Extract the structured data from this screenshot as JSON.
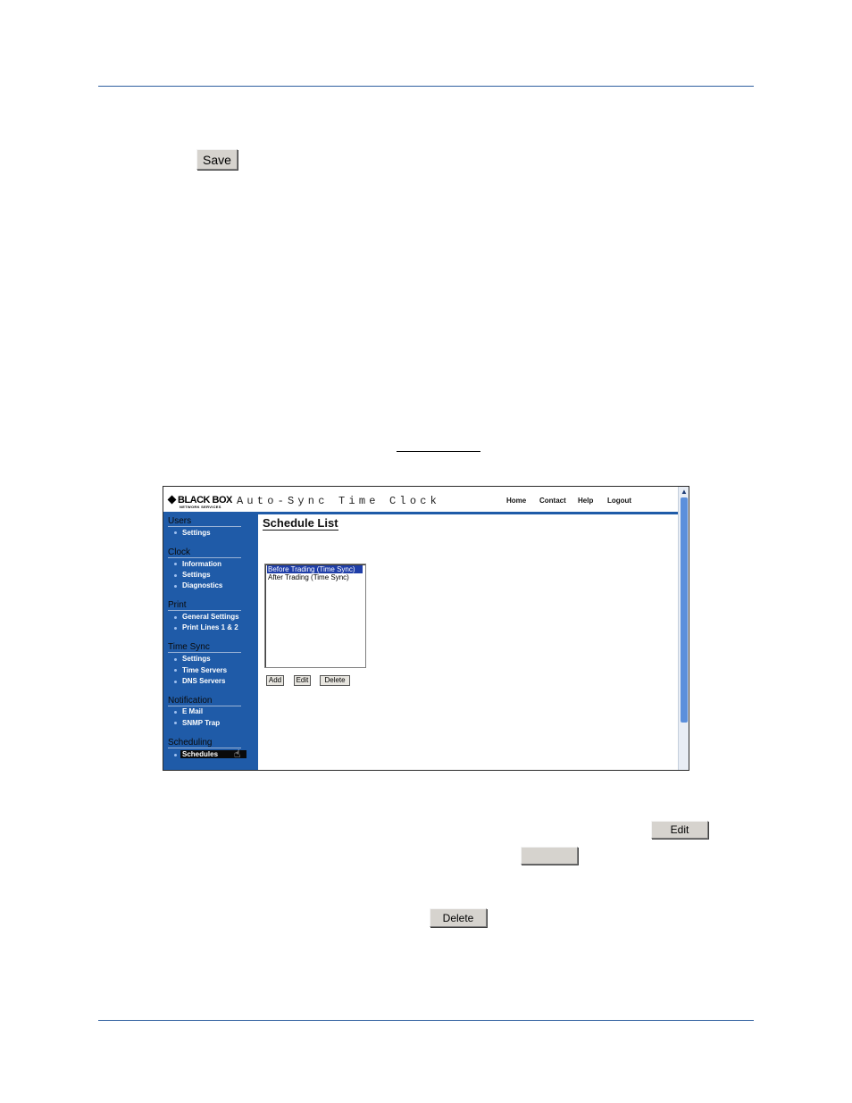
{
  "document": {
    "save_button": "Save",
    "edit_button": "Edit",
    "blank_button": "",
    "delete_button": "Delete"
  },
  "screenshot": {
    "logo": "BLACK BOX",
    "logo_sub": "NETWORK SERVICES",
    "app_title": "Auto-Sync Time Clock",
    "nav": {
      "home": "Home",
      "contact": "Contact",
      "help": "Help",
      "logout": "Logout"
    },
    "sidebar": {
      "users": {
        "title": "Users",
        "items": [
          "Settings"
        ]
      },
      "clock": {
        "title": "Clock",
        "items": [
          "Information",
          "Settings",
          "Diagnostics"
        ]
      },
      "print": {
        "title": "Print",
        "items": [
          "General Settings",
          "Print Lines 1 & 2"
        ]
      },
      "timesync": {
        "title": "Time Sync",
        "items": [
          "Settings",
          "Time Servers",
          "DNS Servers"
        ]
      },
      "notification": {
        "title": "Notification",
        "items": [
          "E Mail",
          "SNMP Trap"
        ]
      },
      "scheduling": {
        "title": "Scheduling",
        "items": [
          "Schedules"
        ]
      }
    },
    "content": {
      "title": "Schedule List",
      "list": [
        "Before Trading (Time Sync)",
        "After Trading (Time Sync)"
      ],
      "buttons": {
        "add": "Add",
        "edit": "Edit",
        "delete": "Delete"
      }
    },
    "colors": {
      "sidebar": "#1f5ba8",
      "selection": "#1f3ea8",
      "rule": "#2f5f9f"
    }
  }
}
